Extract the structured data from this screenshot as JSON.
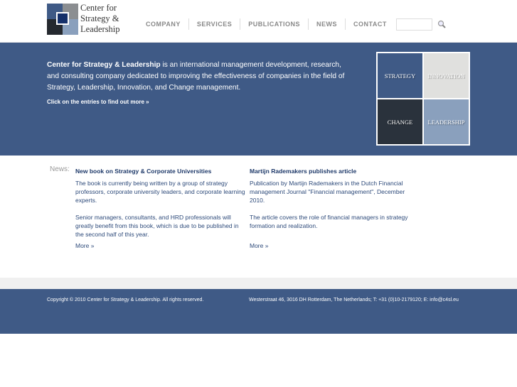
{
  "header": {
    "logo_text": [
      "Center for",
      "Strategy &",
      "Leadership"
    ],
    "nav": [
      "COMPANY",
      "SERVICES",
      "PUBLICATIONS",
      "NEWS",
      "CONTACT"
    ],
    "search": {
      "value": "",
      "placeholder": ""
    },
    "search_icon": "magnifier-icon"
  },
  "banner": {
    "intro_bold": "Center for Strategy & Leadership",
    "intro_rest": " is an international management development, research, and consulting company dedicated to improving the effectiveness of companies in the field of Strategy, Leadership, Innovation, and Change management.",
    "click": "Click on the entries to find out more »",
    "grid": [
      {
        "label": "STRATEGY",
        "color": "#3f5a86"
      },
      {
        "label": "INNOVATION",
        "color": "#e0e0de"
      },
      {
        "label": "CHANGE",
        "color": "#2a323c"
      },
      {
        "label": "LEADERSHIP",
        "color": "#8aa0bd"
      }
    ]
  },
  "news": {
    "label": "News:",
    "items": [
      {
        "title": "New book on Strategy & Corporate Universities",
        "paragraphs": [
          "The book is currently being written by a group of strategy professors, corporate university leaders, and corporate learning experts.",
          "Senior managers, consultants, and HRD professionals will greatly benefit from this book, which is due to be published in the second half of this year."
        ],
        "more": "More »"
      },
      {
        "title": "Martijn Rademakers publishes article",
        "paragraphs": [
          "Publication by Martijn Rademakers in the Dutch Financial management Journal \"Financial management\", December 2010.",
          "The article covers the role of financial managers in strategy formation and realization."
        ],
        "more": "More »"
      }
    ]
  },
  "footer": {
    "copyright": "Copyright © 2010 Center for Strategy & Leadership. All rights reserved.",
    "address": "Westerstraat 46, 3016 DH Rotterdam, The Netherlands; T: +31 (0)10-2179120; E: info@c4sl.eu"
  }
}
